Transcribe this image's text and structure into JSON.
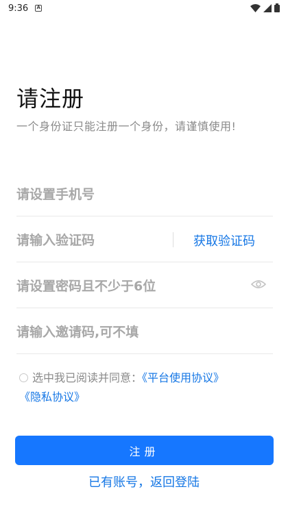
{
  "status": {
    "time": "9:36",
    "notif": "A"
  },
  "header": {
    "title": "请注册",
    "subtitle": "一个身份证只能注册一个身份，请谨慎使用!"
  },
  "form": {
    "phone_placeholder": "请设置手机号",
    "code_placeholder": "请输入验证码",
    "get_code_label": "获取验证码",
    "password_placeholder": "请设置密码且不少于6位",
    "invite_placeholder": "请输入邀请码,可不填"
  },
  "agreement": {
    "prefix": "选中我已阅读并同意：",
    "platform_link": "《平台使用协议》",
    "privacy_link": "《隐私协议》"
  },
  "actions": {
    "register_label": "注册",
    "login_label": "已有账号，返回登陆"
  },
  "colors": {
    "accent": "#1677ff",
    "link": "#1677e5",
    "placeholder": "#a8a8a8"
  }
}
